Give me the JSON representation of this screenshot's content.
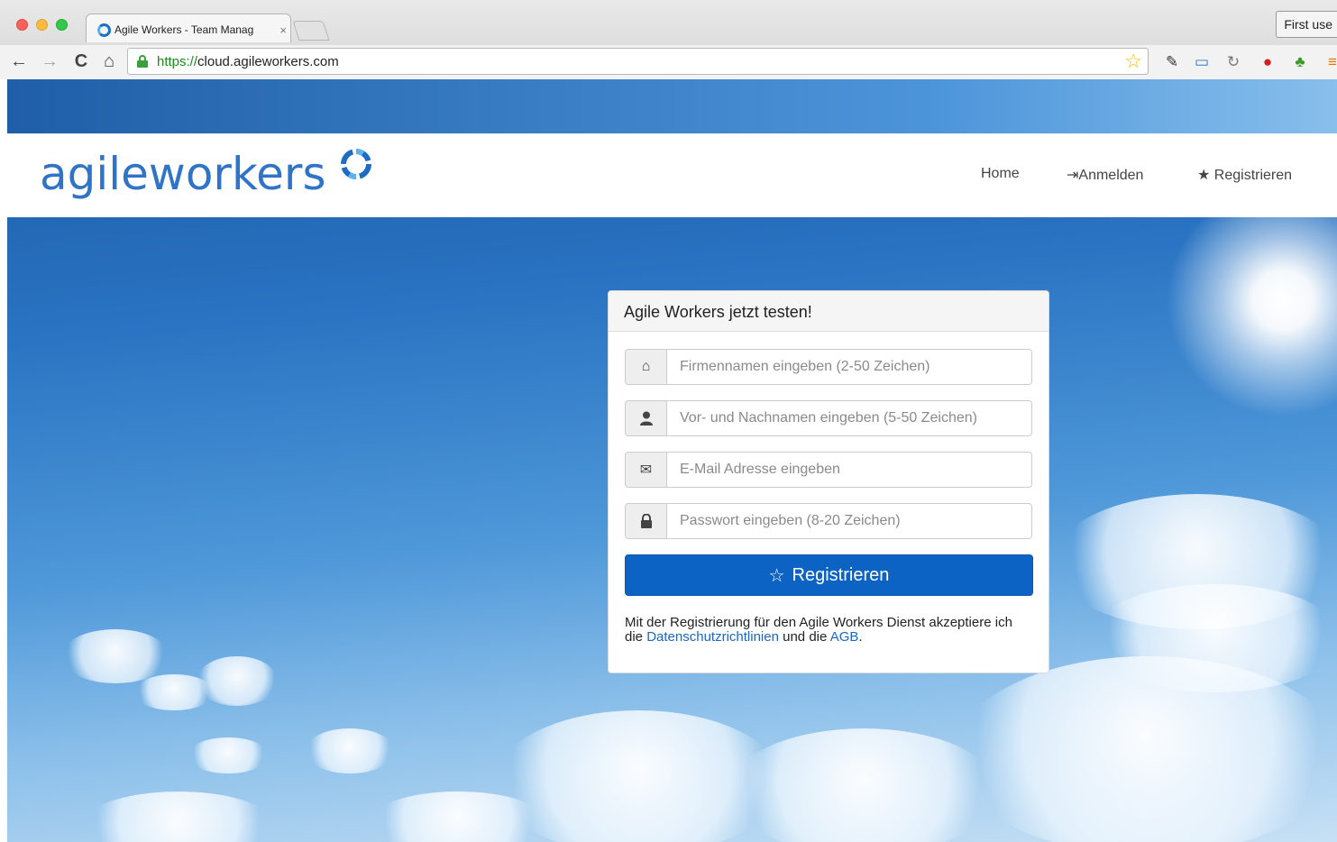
{
  "browser": {
    "tab_title": "Agile Workers - Team Manag",
    "tab_close": "×",
    "url_scheme": "https://",
    "url_host": "cloud.agileworkers.com",
    "profile_button": "First use",
    "icons": [
      "back-icon",
      "forward-icon",
      "reload-icon",
      "home-icon",
      "lock-icon",
      "bookmark-star-icon",
      "extension-icons"
    ]
  },
  "header": {
    "logo_text": "agileworkers",
    "nav": {
      "home": "Home",
      "login": "Anmelden",
      "register": "Registrieren"
    }
  },
  "signup": {
    "heading": "Agile Workers jetzt testen!",
    "fields": {
      "company_placeholder": "Firmennamen eingeben (2-50 Zeichen)",
      "name_placeholder": "Vor- und Nachnamen eingeben (5-50 Zeichen)",
      "email_placeholder": "E-Mail Adresse eingeben",
      "password_placeholder": "Passwort eingeben (8-20 Zeichen)"
    },
    "submit_label": "Registrieren",
    "terms": {
      "prefix": "Mit der Registrierung für den Agile Workers Dienst akzeptiere ich die",
      "privacy_link": "Datenschutzrichtlinien",
      "middle": "und die",
      "agb_link": "AGB",
      "suffix": "."
    }
  },
  "colors": {
    "brand_blue": "#2f74c6",
    "button_blue": "#0c63c4",
    "link_blue": "#1a67c0"
  }
}
